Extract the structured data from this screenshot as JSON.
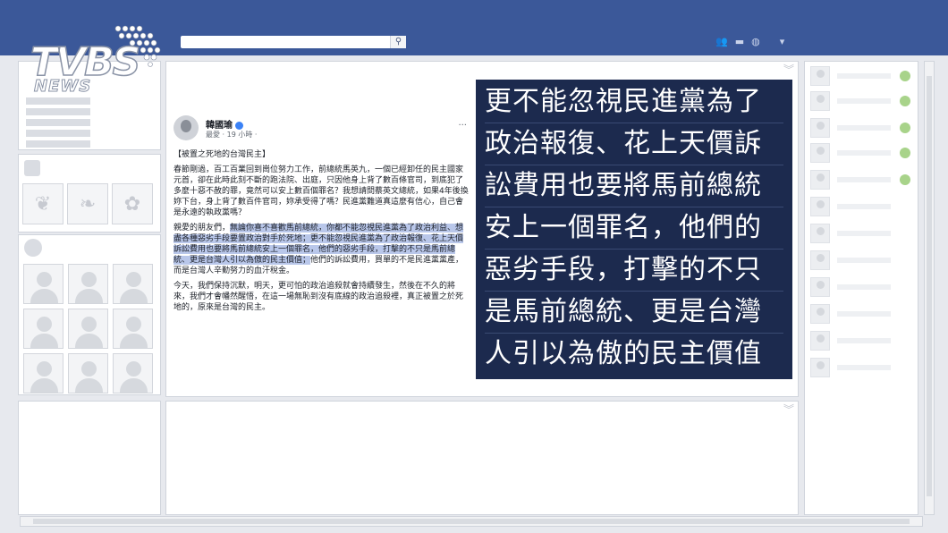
{
  "logo": {
    "brand": "TVBS",
    "sub": "NEWS"
  },
  "search": {
    "icon": "search-icon"
  },
  "post": {
    "author": "韓國瑜",
    "meta": "最愛 · 19 小時 ·",
    "more": "···",
    "title": "【被置之死地的台灣民主】",
    "p1": "春節剛過，百工百業回到崗位努力工作，前總統馬英九，一個已經卸任的民主國家元首，卻在此時此刻不斷的跑法院、出庭，只因他身上背了數百條官司，到底犯了多麼十惡不赦的罪，竟然可以安上數百個罪名？我想請問蔡英文總統，如果4年後換妳下台，身上背了數百件官司，妳承受得了嗎？民進黨難道真這麼有信心，自己會是永遠的執政黨嗎？",
    "p2_start": "親愛的朋友們，",
    "p2_highlight": "無論你喜不喜歡馬前總統，你都不能忽視民進黨為了政治利益、想盡各種惡劣手段要置政治對手於死地；更不能忽視民進黨為了政治報復、花上天價訴訟費用也要將馬前總統安上一個罪名，他們的惡劣手段，打擊的不只是馬前總統、更是台灣人引以為傲的民主價值；",
    "p2_end": "他們的訴訟費用，買單的不是民進黨黨產，而是台灣人辛勤努力的血汗稅金。",
    "p3": "今天，我們保持沉默，明天，更可怕的政治追殺就會持續發生，然後在不久的將來，我們才會幡然醒悟，在這一場無恥到沒有底線的政治追殺裡，真正被置之於死地的，原來是台灣的民主。"
  },
  "overlay": {
    "lines": [
      "更不能忽視民進黨為了",
      "政治報復、花上天價訴",
      "訟費用也要將馬前總統",
      "安上一個罪名，他們的",
      "惡劣手段，打擊的不只",
      "是馬前總統、更是台灣",
      "人引以為傲的民主價值"
    ]
  },
  "colors": {
    "topbar": "#3b5899",
    "overlay_bg": "#1c2a4e",
    "highlight": "#b9c7ea",
    "online": "#a8d38a"
  }
}
